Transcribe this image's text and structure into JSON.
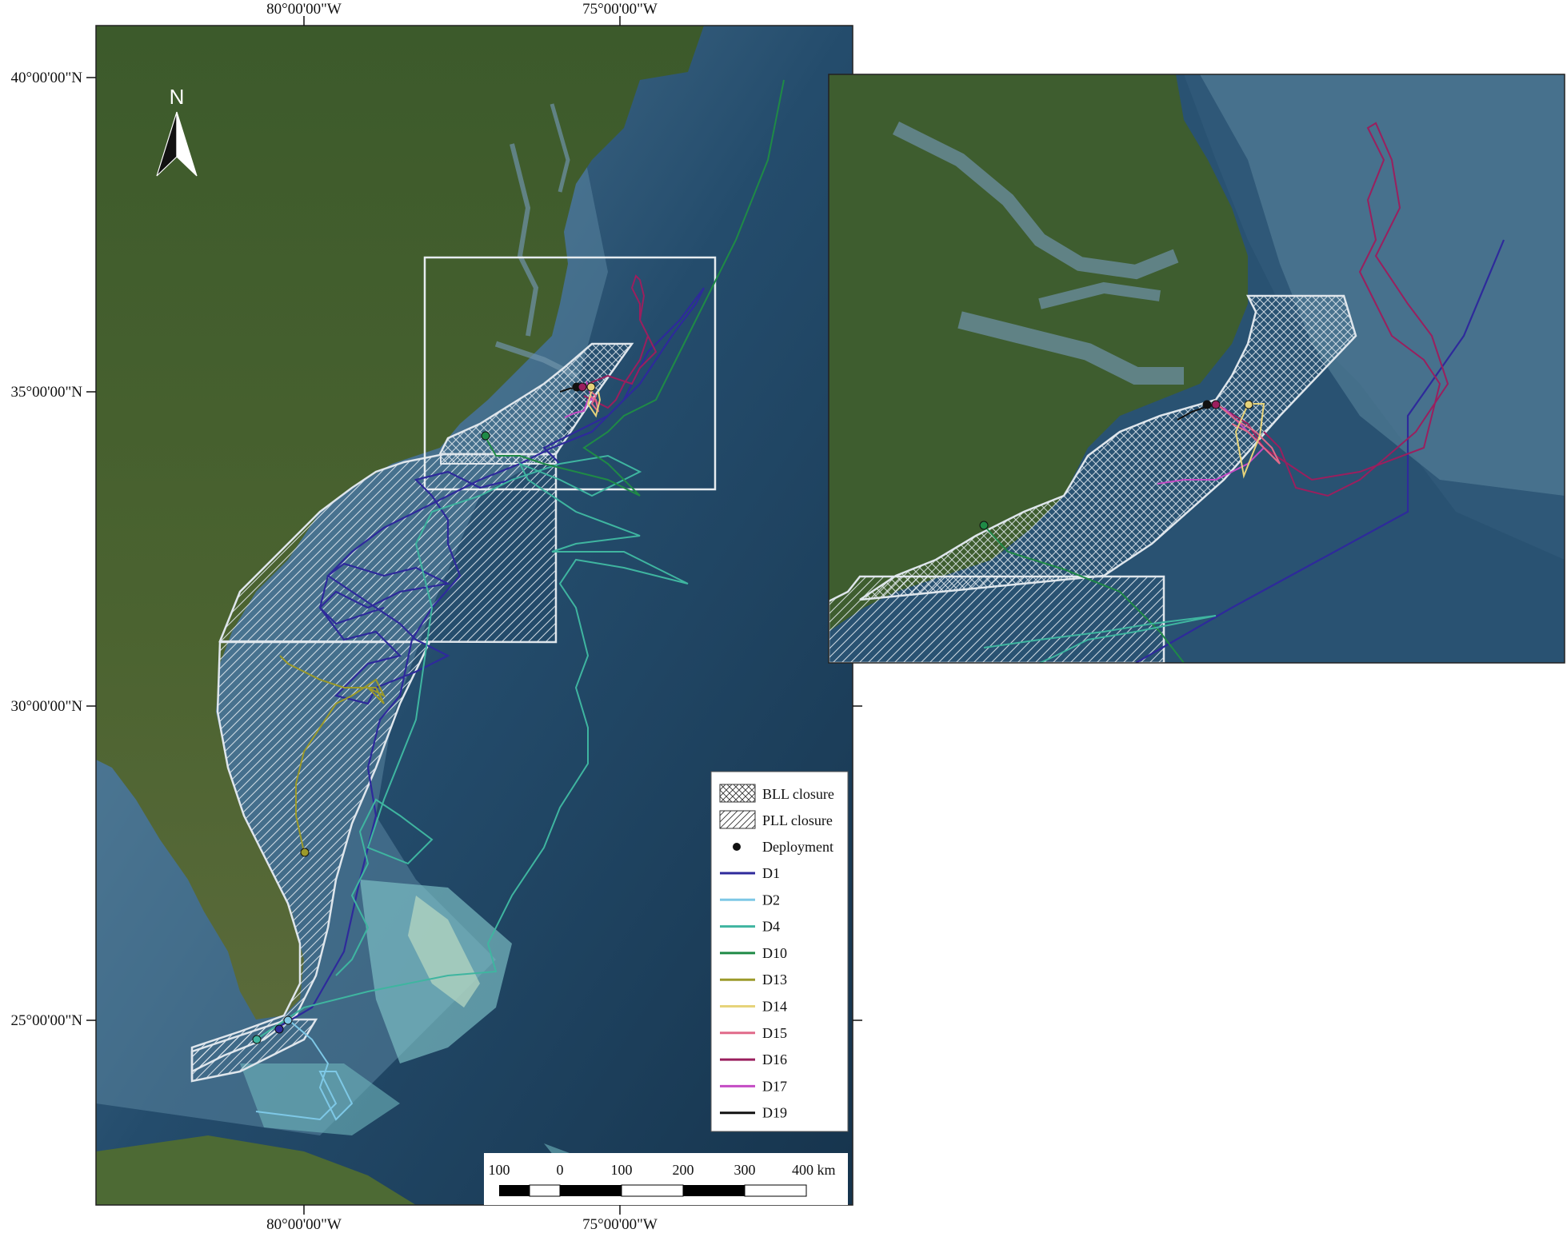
{
  "main_map": {
    "top_labels": [
      "80°00'00\"W",
      "75°00'00\"W"
    ],
    "bottom_labels": [
      "80°00'00\"W",
      "75°00'00\"W"
    ],
    "left_labels": [
      "40°00'00\"N",
      "35°00'00\"N",
      "30°00'00\"N",
      "25°00'00\"N"
    ],
    "north_arrow_label": "N"
  },
  "legend": {
    "items": [
      {
        "label": "BLL closure",
        "type": "crosshatch"
      },
      {
        "label": "PLL closure",
        "type": "diagonal"
      },
      {
        "label": "Deployment",
        "type": "point"
      },
      {
        "label": "D1",
        "type": "line",
        "color": "#2e2a9b"
      },
      {
        "label": "D2",
        "type": "line",
        "color": "#7ec8e6"
      },
      {
        "label": "D4",
        "type": "line",
        "color": "#3fb5a0"
      },
      {
        "label": "D10",
        "type": "line",
        "color": "#1f8a46"
      },
      {
        "label": "D13",
        "type": "line",
        "color": "#9c9a2a"
      },
      {
        "label": "D14",
        "type": "line",
        "color": "#e6d37a"
      },
      {
        "label": "D15",
        "type": "line",
        "color": "#e06a8a"
      },
      {
        "label": "D16",
        "type": "line",
        "color": "#9a1f5e"
      },
      {
        "label": "D17",
        "type": "line",
        "color": "#c44bc4"
      },
      {
        "label": "D19",
        "type": "line",
        "color": "#111111"
      }
    ]
  },
  "scale_bar": {
    "labels": [
      "100",
      "0",
      "100",
      "200",
      "300",
      "400 km"
    ]
  },
  "colors": {
    "ocean_deep": "#1c3f5a",
    "ocean_shelf": "#4d7894",
    "land": "#3b5a2c",
    "closure_outline": "#dfe6ec"
  }
}
